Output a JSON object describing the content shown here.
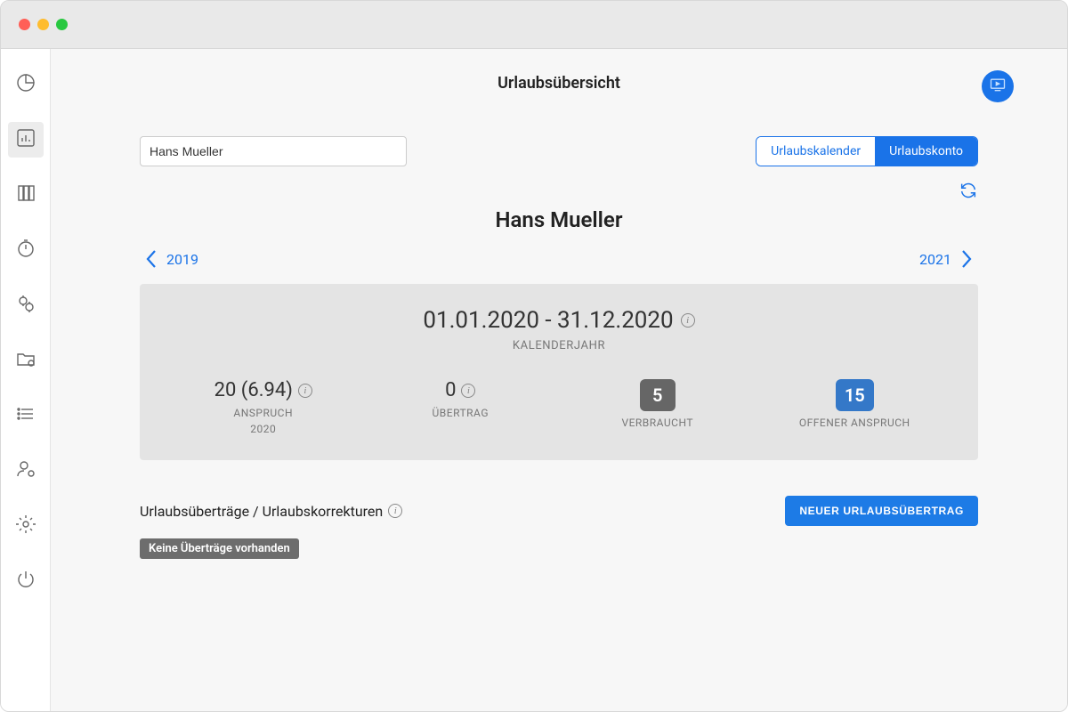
{
  "window": {
    "title": "Urlaubsübersicht"
  },
  "header": {
    "page_title": "Urlaubsübersicht"
  },
  "search": {
    "value": "Hans Mueller"
  },
  "tabs": {
    "calendar": "Urlaubskalender",
    "account": "Urlaubskonto",
    "active": "account"
  },
  "person": {
    "name": "Hans Mueller"
  },
  "year_nav": {
    "prev": "2019",
    "next": "2021"
  },
  "summary": {
    "period": "01.01.2020 - 31.12.2020",
    "period_sub": "KALENDERJAHR",
    "stats": {
      "anspruch": {
        "value": "20 (6.94)",
        "label": "ANSPRUCH",
        "sublabel": "2020"
      },
      "uebertrag": {
        "value": "0",
        "label": "ÜBERTRAG"
      },
      "verbraucht": {
        "value": "5",
        "label": "VERBRAUCHT"
      },
      "offen": {
        "value": "15",
        "label": "OFFENER ANSPRUCH"
      }
    }
  },
  "transfers": {
    "title": "Urlaubsüberträge / Urlaubskorrekturen",
    "button": "NEUER URLAUBSÜBERTRAG",
    "empty": "Keine Überträge vorhanden"
  },
  "colors": {
    "accent": "#1a73e8",
    "pill_gray": "#666666",
    "pill_blue": "#3478c8"
  }
}
